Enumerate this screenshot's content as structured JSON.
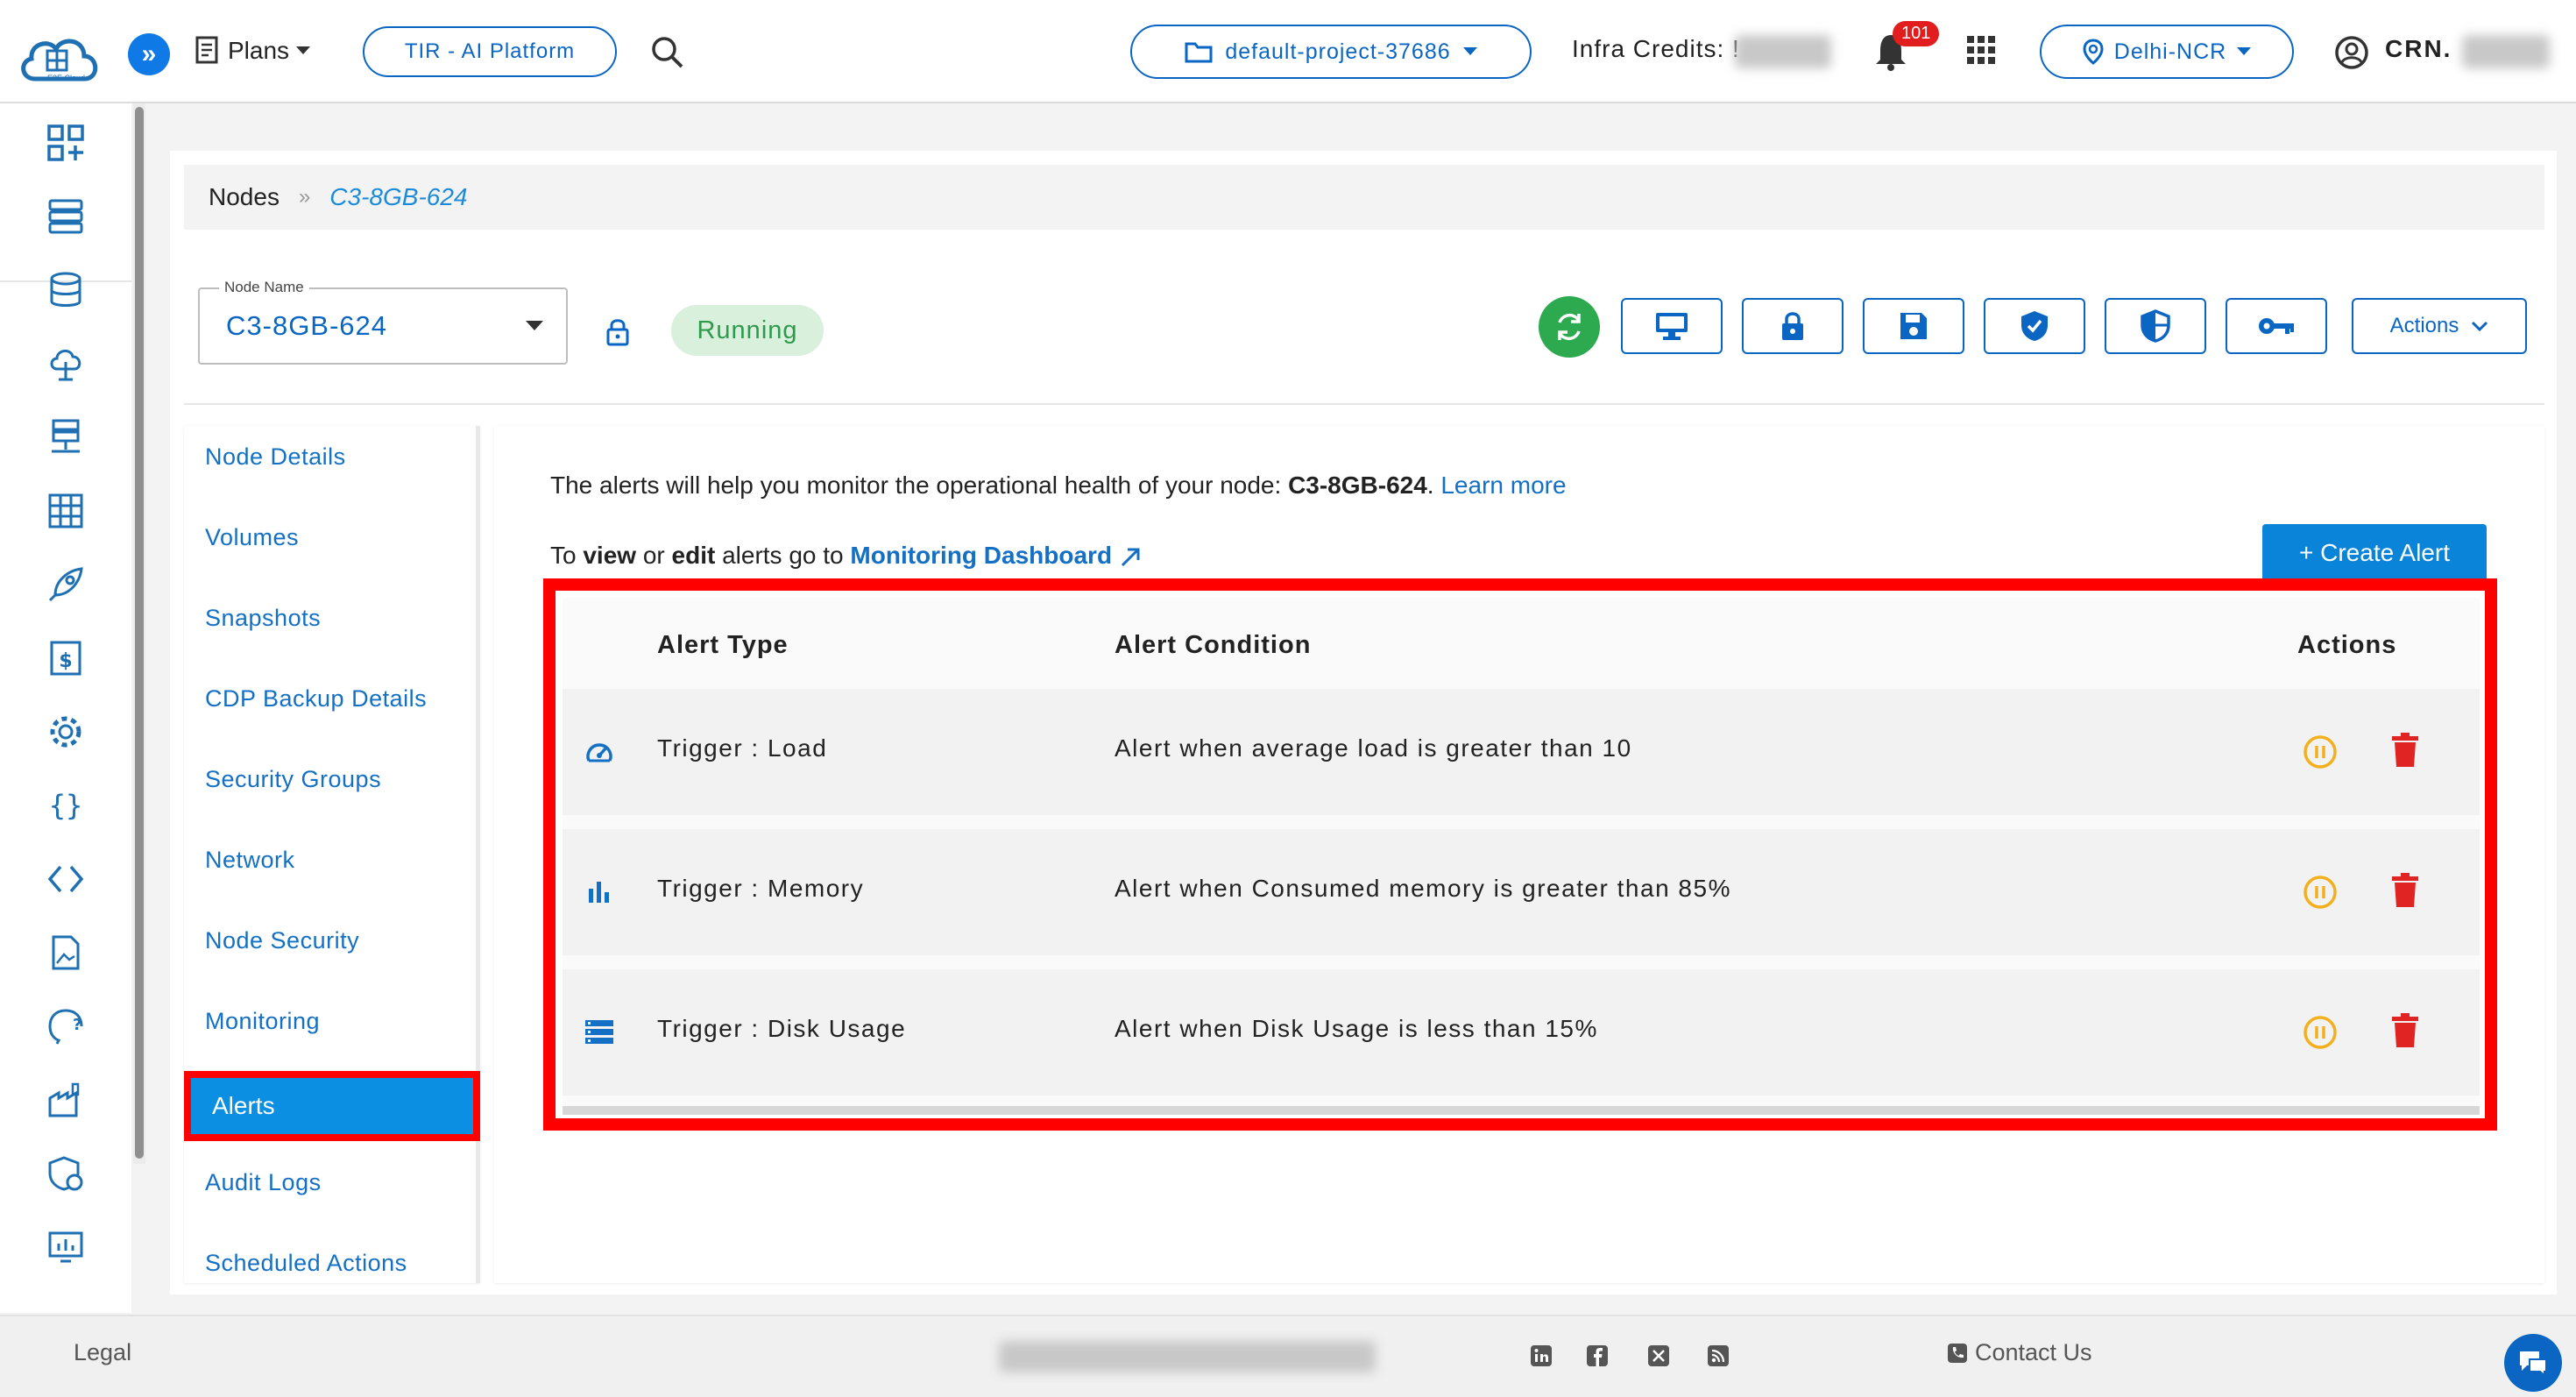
{
  "header": {
    "logo_text": "E2E Cloud",
    "plans_label": "Plans",
    "platform_button": "TIR - AI Platform",
    "project_selector": "default-project-37686",
    "infra_credits_label": "Infra Credits: !",
    "notification_count": "101",
    "region_selector": "Delhi-NCR",
    "user_label": "CRN."
  },
  "breadcrumb": {
    "root": "Nodes",
    "separator": "»",
    "current": "C3-8GB-624"
  },
  "node": {
    "field_label": "Node Name",
    "name": "C3-8GB-624",
    "status": "Running"
  },
  "toolbar": {
    "actions_label": "Actions"
  },
  "subnav": {
    "items": [
      {
        "label": "Node Details"
      },
      {
        "label": "Volumes"
      },
      {
        "label": "Snapshots"
      },
      {
        "label": "CDP Backup Details"
      },
      {
        "label": "Security Groups"
      },
      {
        "label": "Network"
      },
      {
        "label": "Node Security"
      },
      {
        "label": "Monitoring"
      },
      {
        "label": "Alerts"
      },
      {
        "label": "Audit Logs"
      },
      {
        "label": "Scheduled Actions"
      }
    ],
    "active": "Alerts"
  },
  "content": {
    "intro_text": "The alerts will help you monitor the operational health of your node: ",
    "intro_node": "C3-8GB-624",
    "intro_suffix": ". ",
    "learn_more": "Learn more",
    "goto_prefix": "To ",
    "goto_view": "view",
    "goto_or": " or ",
    "goto_edit": "edit",
    "goto_middle": " alerts go to ",
    "monitoring_dashboard": "Monitoring Dashboard",
    "create_alert": "+ Create Alert"
  },
  "alerts_table": {
    "headers": {
      "type": "Alert Type",
      "condition": "Alert Condition",
      "actions": "Actions"
    },
    "rows": [
      {
        "icon": "speedometer-icon",
        "type": "Trigger : Load",
        "condition": "Alert when average load is greater than 10"
      },
      {
        "icon": "bar-chart-icon",
        "type": "Trigger : Memory",
        "condition": "Alert when Consumed memory is greater than 85%"
      },
      {
        "icon": "storage-list-icon",
        "type": "Trigger : Disk Usage",
        "condition": "Alert when Disk Usage is less than 15%"
      }
    ]
  },
  "footer": {
    "legal": "Legal",
    "contact": "Contact Us"
  },
  "colors": {
    "primary": "#0a66c2",
    "active_nav": "#0a8fe3",
    "highlight_border": "#ff0000",
    "running_bg": "#d8f0dc",
    "running_text": "#2e9a4c",
    "pause_icon": "#f2b01e",
    "delete_icon": "#e02424",
    "refresh_btn": "#2da94f"
  }
}
